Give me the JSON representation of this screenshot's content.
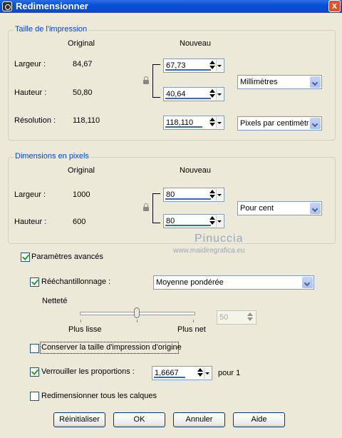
{
  "window": {
    "title": "Redimensionner",
    "close": "x"
  },
  "print_size": {
    "legend": "Taille de l'impression",
    "col_original": "Original",
    "col_new": "Nouveau",
    "width_label": "Largeur :",
    "width_original": "84,67",
    "width_new": "67,73",
    "height_label": "Hauteur :",
    "height_original": "50,80",
    "height_new": "40,64",
    "unit": "Millimètres",
    "resolution_label": "Résolution :",
    "resolution_original": "118,110",
    "resolution_new": "118,110",
    "resolution_unit": "Pixels par centimètre"
  },
  "pixel_size": {
    "legend": "Dimensions en pixels",
    "col_original": "Original",
    "col_new": "Nouveau",
    "width_label": "Largeur :",
    "width_original": "1000",
    "width_new": "80",
    "height_label": "Hauteur :",
    "height_original": "600",
    "height_new": "80",
    "unit": "Pour cent"
  },
  "watermark": {
    "line1": "Pinuccia",
    "line2": "www.maidiregrafica.eu"
  },
  "advanced": {
    "label": "Paramètres avancés",
    "checked": true
  },
  "resample": {
    "label": "Rééchantillonnage :",
    "checked": true,
    "method": "Moyenne pondérée"
  },
  "sharpness": {
    "label": "Netteté",
    "min_label": "Plus lisse",
    "max_label": "Plus net",
    "value": "50",
    "level_fraction": 0.5
  },
  "keep_print_size": {
    "label": "Conserver la taille d'impression d'origine",
    "checked": false
  },
  "lock_ratio": {
    "label": "Verrouiller les proportions :",
    "checked": true,
    "value": "1,6667",
    "suffix": "pour 1"
  },
  "resize_all_layers": {
    "label": "Redimensionner tous les calques",
    "checked": false
  },
  "buttons": {
    "reset": "Réinitialiser",
    "ok": "OK",
    "cancel": "Annuler",
    "help": "Aide"
  }
}
